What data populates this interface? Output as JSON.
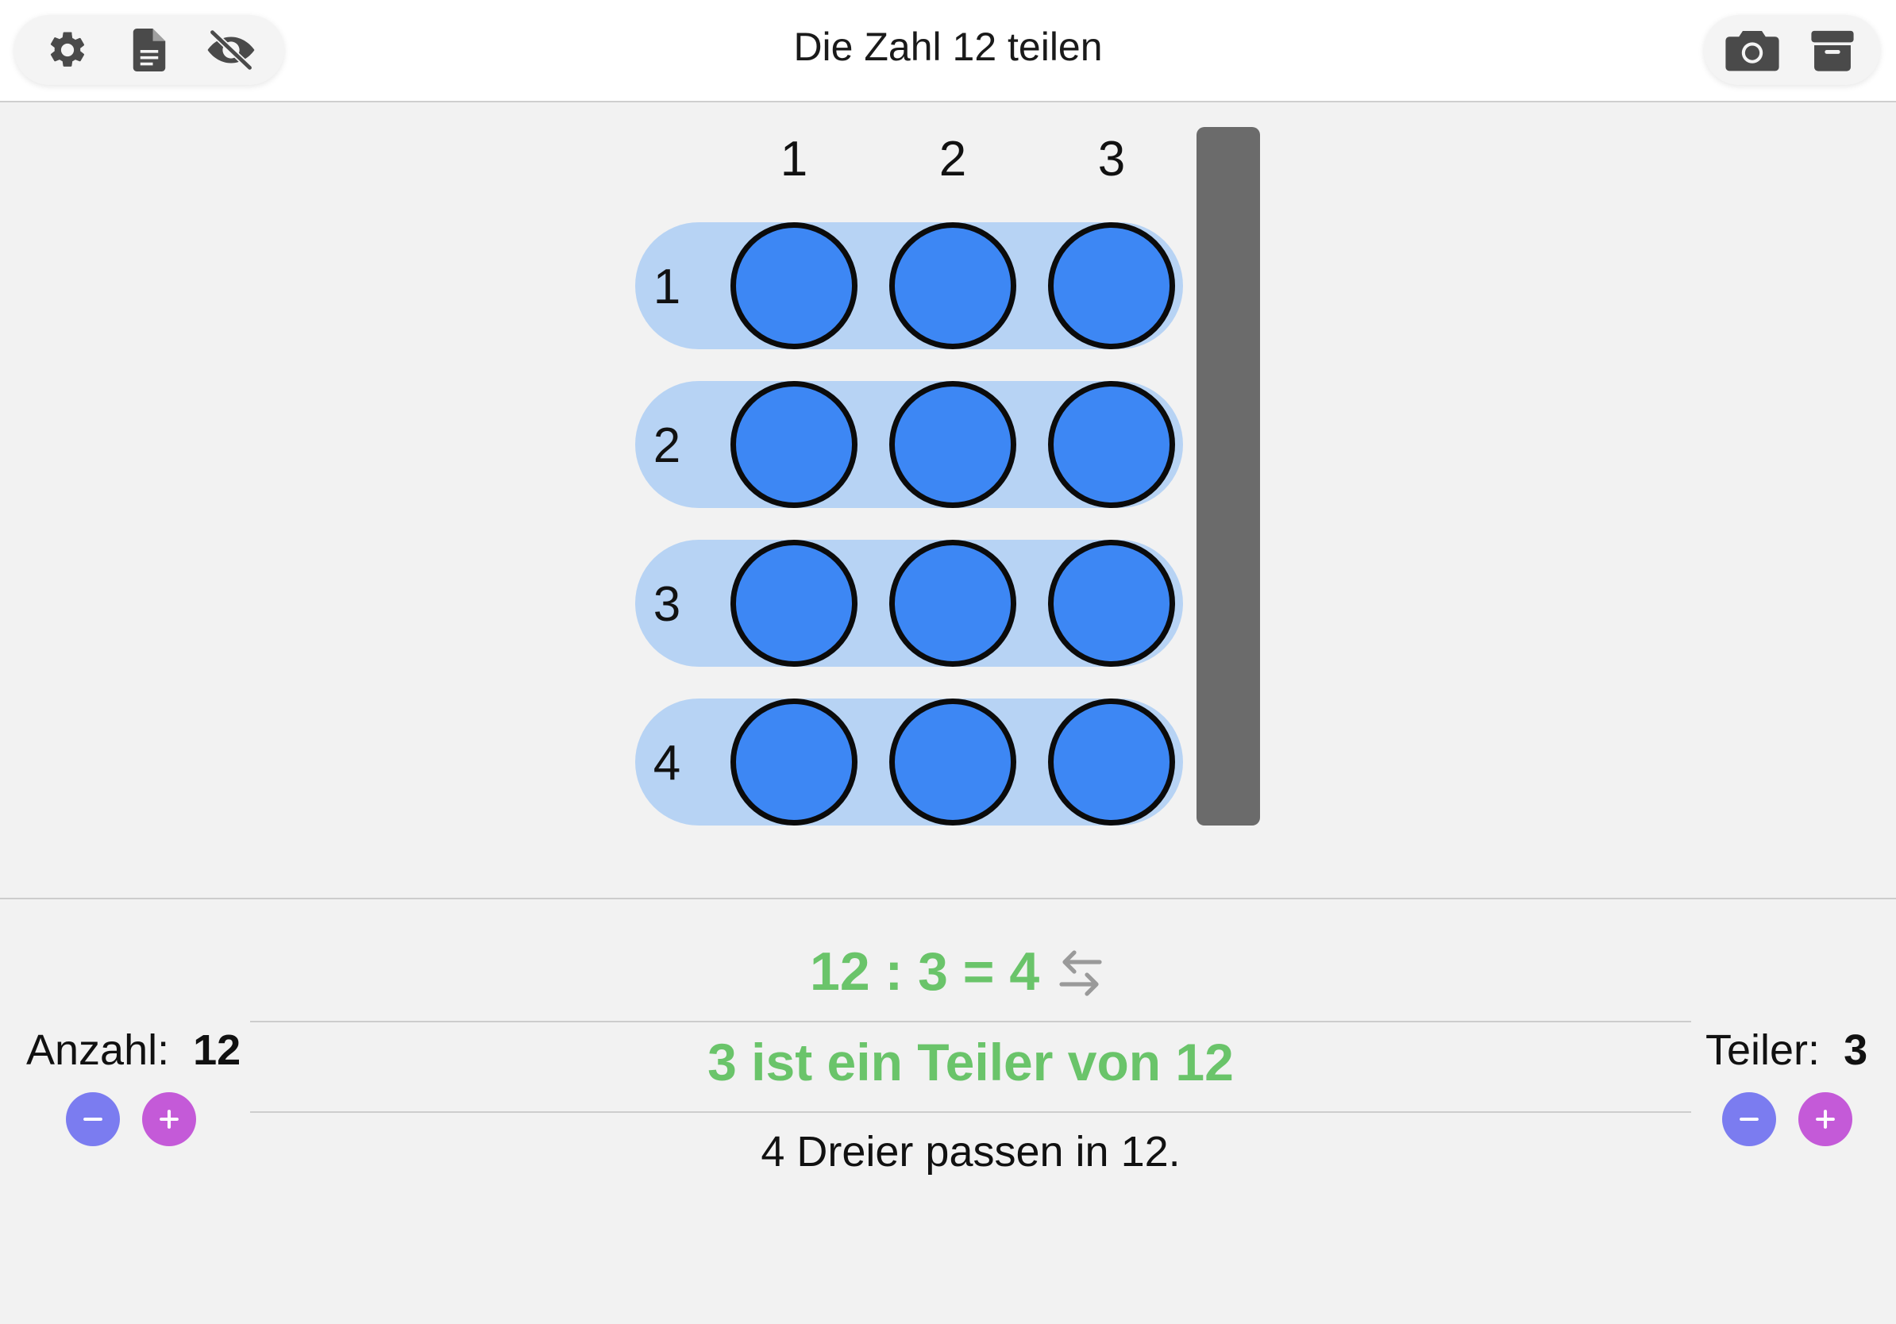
{
  "header": {
    "title": "Die Zahl 12 teilen",
    "left_icons": [
      "gear-icon",
      "document-icon",
      "eye-slash-icon"
    ],
    "right_icons": [
      "camera-icon",
      "archive-icon"
    ]
  },
  "grid": {
    "column_labels": [
      "1",
      "2",
      "3"
    ],
    "row_labels": [
      "1",
      "2",
      "3",
      "4"
    ],
    "dot_color": "#3d87f4",
    "band_color": "#b7d3f4"
  },
  "result": {
    "equation": "12 : 3 = 4",
    "statement": "3 ist ein Teiler von 12",
    "note": "4 Dreier passen in 12.",
    "accent_color": "#6ac46a"
  },
  "left_control": {
    "label": "Anzahl:",
    "value": "12"
  },
  "right_control": {
    "label": "Teiler:",
    "value": "3"
  },
  "buttons": {
    "minus_color": "#7b7cf0",
    "plus_color": "#c45ad8"
  }
}
